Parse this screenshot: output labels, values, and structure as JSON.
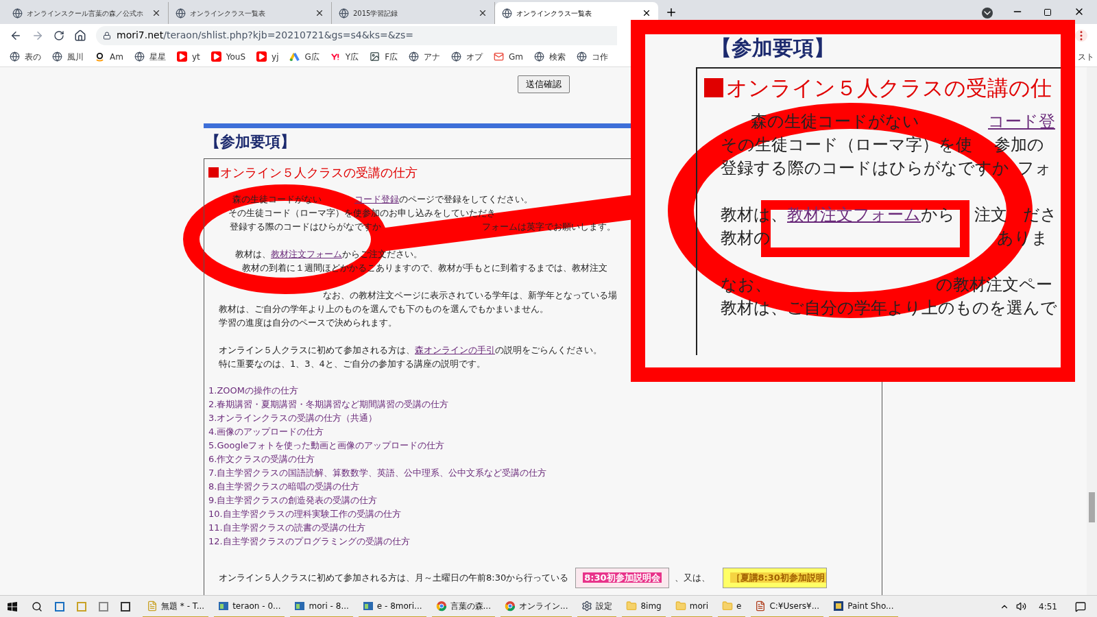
{
  "browser": {
    "tabs": [
      {
        "title": "オンラインスクール言葉の森／公式ホ",
        "selected": false
      },
      {
        "title": "オンラインクラス一覧表",
        "selected": false
      },
      {
        "title": "2015学習記録",
        "selected": false
      },
      {
        "title": "オンラインクラス一覧表",
        "selected": true
      }
    ],
    "url": {
      "domain": "mori7.net",
      "path": "/teraon/shlist.php?kjb=20210721&gs=s4&ks=&zs="
    },
    "bookmarks": [
      {
        "label": "表の",
        "kind": "globe"
      },
      {
        "label": "風川",
        "kind": "globe"
      },
      {
        "label": "Am",
        "kind": "amazon"
      },
      {
        "label": "星星",
        "kind": "globe"
      },
      {
        "label": "yt",
        "kind": "video"
      },
      {
        "label": "YouS",
        "kind": "video"
      },
      {
        "label": "yj",
        "kind": "video"
      },
      {
        "label": "G広",
        "kind": "ads"
      },
      {
        "label": "Y広",
        "kind": "yahoo"
      },
      {
        "label": "F広",
        "kind": "image"
      },
      {
        "label": "アナ",
        "kind": "globe"
      },
      {
        "label": "オプ",
        "kind": "globe"
      },
      {
        "label": "Gm",
        "kind": "mail"
      },
      {
        "label": "検索",
        "kind": "globe"
      },
      {
        "label": "コ作",
        "kind": "globe"
      }
    ],
    "bookmarks_tail": "スト"
  },
  "page": {
    "submit_button": "送信確認",
    "section_title": "【参加要項】",
    "box_title": "オンライン５人クラスの受講の仕方",
    "paragraph_lines": [
      {
        "spaced": false,
        "segments": [
          [
            {
              "text": "森の生徒コードがない",
              "link": false
            }
          ],
          [
            {
              "text": "コード登録",
              "link": true
            },
            {
              "text": "のページで登録をしてください。",
              "link": false
            }
          ]
        ]
      },
      {
        "spaced": false,
        "segments": [
          [
            {
              "text": "その生徒コード（ローマ字）を使",
              "link": false
            }
          ],
          [
            {
              "text": "参加のお申し込みをしていただき",
              "link": false
            }
          ]
        ]
      },
      {
        "spaced": false,
        "segments": [
          [
            {
              "text": "登録する際のコードはひらがなですか",
              "link": false
            }
          ],
          [
            {
              "text": "フォーム",
              "link": false
            }
          ],
          [
            {
              "text": "は英字でお願いします。",
              "link": false
            }
          ]
        ]
      },
      {
        "spaced": true,
        "segments": [
          [
            {
              "text": "教材は、",
              "link": false
            },
            {
              "text": "教材注文フォーム",
              "link": true
            },
            {
              "text": "からご注文",
              "link": false
            }
          ],
          [
            {
              "text": "ださい。",
              "link": false
            }
          ]
        ]
      },
      {
        "spaced": false,
        "segments": [
          [
            {
              "text": "教材の到着に１週間ほどかかるこ",
              "link": false
            }
          ],
          [
            {
              "text": "ありますので、教材が手もとに到着するまでは、教材注文",
              "link": false
            }
          ]
        ]
      },
      {
        "spaced": true,
        "segments": [
          [
            {
              "text": "なお、",
              "link": false
            }
          ],
          [
            {
              "text": "の教材注文ページに表示されている学年は、新学年となっている場",
              "link": false
            }
          ]
        ]
      },
      {
        "spaced": false,
        "segments": [
          [
            {
              "text": "教材は、ご自分の学年より上のものを選んでも下のものを選んでもかまいません。",
              "link": false
            }
          ]
        ]
      },
      {
        "spaced": false,
        "segments": [
          [
            {
              "text": "学習の進度は自分のペースで決められます。",
              "link": false
            }
          ]
        ]
      },
      {
        "spaced": true,
        "segments": [
          [
            {
              "text": "オンライン５人クラスに初めて参加される方は、",
              "link": false
            },
            {
              "text": "森オンラインの手引",
              "link": true
            },
            {
              "text": "の説明をごらんください。",
              "link": false
            }
          ]
        ]
      },
      {
        "spaced": false,
        "segments": [
          [
            {
              "text": "特に重要なのは、1、3、4と、ご自分の参加する講座の説明です。",
              "link": false
            }
          ]
        ]
      }
    ],
    "guide_links": [
      "1.ZOOMの操作の仕方",
      "2.春期講習・夏期講習・冬期講習など期間講習の受講の仕方",
      "3.オンラインクラスの受講の仕方（共通）",
      "4.画像のアップロードの仕方",
      "5.Googleフォトを使った動画と画像のアップロードの仕方",
      "6.作文クラスの受講の仕方",
      "7.自主学習クラスの国語読解、算数数学、英語、公中理系、公中文系など受講の仕方",
      "8.自主学習クラスの暗唱の受講の仕方",
      "9.自主学習クラスの創造発表の受講の仕方",
      "10.自主学習クラスの理科実験工作の受講の仕方",
      "11.自主学習クラスの読書の受講の仕方",
      "12.自主学習クラスのプログラミングの受講の仕方"
    ],
    "bottom": {
      "text": "オンライン５人クラスに初めて参加される方は、月～土曜日の午前8:30から行っている",
      "button_1": "8:30初参加説明会",
      "joiner": "、又は、",
      "button_2": "［夏講8:30初参加説明"
    }
  },
  "callout": {
    "section_title": "【参加要項】",
    "box_title": "オンライン５人クラスの受講の仕",
    "lines": [
      {
        "spaced": false,
        "segments": [
          [
            {
              "text": "森の生徒コードがない",
              "link": false
            }
          ],
          [
            {
              "text": "コード登",
              "link": true
            }
          ]
        ]
      },
      {
        "spaced": false,
        "segments": [
          [
            {
              "text": "その生徒コード（ローマ字）を使",
              "link": false
            }
          ],
          [
            {
              "text": "参加の",
              "link": false
            }
          ]
        ]
      },
      {
        "spaced": false,
        "segments": [
          [
            {
              "text": "登録する際のコードはひらがなですか",
              "link": false
            }
          ],
          [
            {
              "text": "フォ",
              "link": false
            }
          ]
        ]
      },
      {
        "spaced": true,
        "segments": [
          [
            {
              "text": "教材は",
              "link": false
            }
          ],
          [
            {
              "text": "、",
              "link": false
            },
            {
              "text": "教材注文フォーム",
              "link": true
            },
            {
              "text": "から",
              "link": false
            }
          ],
          [
            {
              "text": "注文",
              "link": false
            }
          ],
          [
            {
              "text": "ださ",
              "link": false
            }
          ]
        ]
      },
      {
        "spaced": false,
        "segments": [
          [
            {
              "text": "教材の",
              "link": false
            }
          ],
          [
            {
              "text": "ありま",
              "link": false
            }
          ]
        ]
      },
      {
        "spaced": true,
        "segments": [
          [
            {
              "text": "なお、",
              "link": false
            }
          ],
          [
            {
              "text": "の教材注文ペー",
              "link": false
            }
          ]
        ]
      },
      {
        "spaced": false,
        "segments": [
          [
            {
              "text": "教材は、ご自分の学年より上のものを選んで",
              "link": false
            }
          ]
        ]
      }
    ]
  },
  "taskbar": {
    "windows": [
      {
        "label": "無題 * - T...",
        "kind": "notepad"
      },
      {
        "label": "teraon - 0...",
        "kind": "ftp"
      },
      {
        "label": "mori - 8...",
        "kind": "ftp"
      },
      {
        "label": "e - 8mori...",
        "kind": "ftp"
      },
      {
        "label": "言葉の森...",
        "kind": "browser"
      },
      {
        "label": "オンライン...",
        "kind": "browser"
      },
      {
        "label": "設定",
        "kind": "settings"
      },
      {
        "label": "8img",
        "kind": "folder"
      },
      {
        "label": "mori",
        "kind": "folder"
      },
      {
        "label": "e",
        "kind": "folder"
      },
      {
        "label": "C:¥Users¥...",
        "kind": "editor"
      },
      {
        "label": "Paint Sho...",
        "kind": "paint"
      }
    ],
    "clock": "4:51"
  }
}
